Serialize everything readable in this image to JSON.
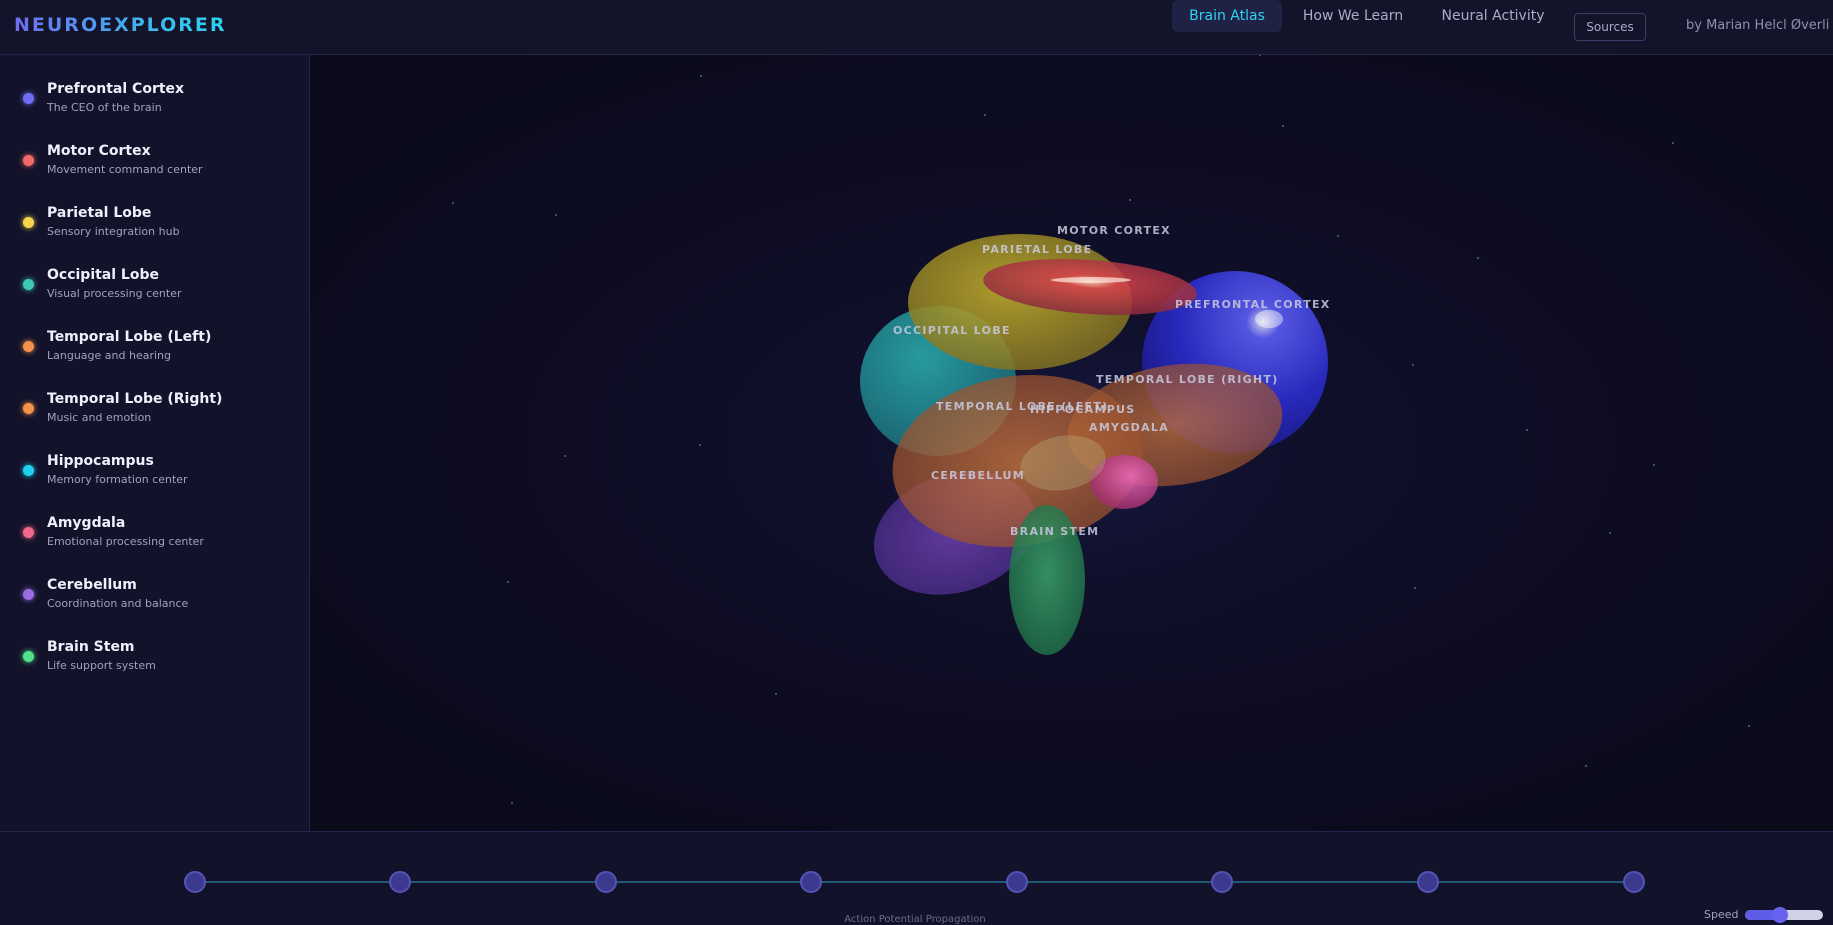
{
  "app": {
    "logo": "NEUROEXPLORER",
    "author": "by Marian Helcl Øverli"
  },
  "nav": {
    "tabs": [
      {
        "label": "Brain Atlas",
        "active": true
      },
      {
        "label": "How We Learn",
        "active": false
      },
      {
        "label": "Neural Activity",
        "active": false
      }
    ],
    "sources_label": "Sources"
  },
  "sidebar": {
    "items": [
      {
        "name": "Prefrontal Cortex",
        "desc": "The CEO of the brain",
        "color": "#6f6cf2"
      },
      {
        "name": "Motor Cortex",
        "desc": "Movement command center",
        "color": "#f26b6b"
      },
      {
        "name": "Parietal Lobe",
        "desc": "Sensory integration hub",
        "color": "#f7d64a"
      },
      {
        "name": "Occipital Lobe",
        "desc": "Visual processing center",
        "color": "#3fc9b4"
      },
      {
        "name": "Temporal Lobe (Left)",
        "desc": "Language and hearing",
        "color": "#f5904a"
      },
      {
        "name": "Temporal Lobe (Right)",
        "desc": "Music and emotion",
        "color": "#f5904a"
      },
      {
        "name": "Hippocampus",
        "desc": "Memory formation center",
        "color": "#1fd2ef"
      },
      {
        "name": "Amygdala",
        "desc": "Emotional processing center",
        "color": "#f2688a"
      },
      {
        "name": "Cerebellum",
        "desc": "Coordination and balance",
        "color": "#9b6ce0"
      },
      {
        "name": "Brain Stem",
        "desc": "Life support system",
        "color": "#54e08a"
      }
    ]
  },
  "brain": {
    "labels": {
      "motor_cortex": "MOTOR CORTEX",
      "parietal_lobe": "PARIETAL LOBE",
      "prefrontal_cortex": "PREFRONTAL CORTEX",
      "occipital_lobe": "OCCIPITAL LOBE",
      "temporal_lobe_right": "TEMPORAL LOBE (RIGHT)",
      "temporal_lobe_left": "TEMPORAL LOBE (LEFT)",
      "hippocampus": "HIPPOCAMPUS",
      "amygdala": "AMYGDALA",
      "cerebellum": "CEREBELLUM",
      "brain_stem": "BRAIN STEM"
    }
  },
  "bottom": {
    "caption": "Action Potential Propagation",
    "speed_label": "Speed",
    "speed_value": 0.45,
    "node_count": 8
  }
}
